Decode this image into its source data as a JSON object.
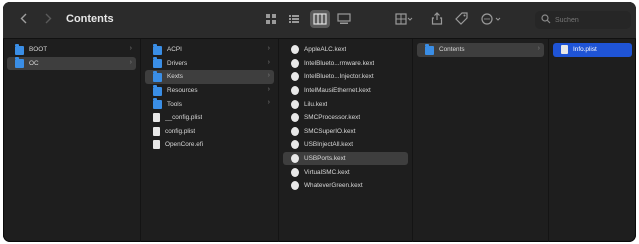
{
  "toolbar": {
    "back_icon": "chevron-left-icon",
    "forward_icon": "chevron-right-icon",
    "title": "Contents",
    "search_placeholder": "Suchen"
  },
  "columns": {
    "col1": [
      {
        "label": "BOOT",
        "icon": "folder-icon",
        "chevron": "›",
        "state": "normal"
      },
      {
        "label": "OC",
        "icon": "folder-icon",
        "chevron": "›",
        "state": "selected"
      }
    ],
    "col2": [
      {
        "label": "ACPI",
        "icon": "folder-icon",
        "chevron": "›",
        "state": "normal"
      },
      {
        "label": "Drivers",
        "icon": "folder-icon",
        "chevron": "›",
        "state": "normal"
      },
      {
        "label": "Kexts",
        "icon": "folder-icon",
        "chevron": "›",
        "state": "selected"
      },
      {
        "label": "Resources",
        "icon": "folder-icon",
        "chevron": "›",
        "state": "normal"
      },
      {
        "label": "Tools",
        "icon": "folder-icon",
        "chevron": "›",
        "state": "normal"
      },
      {
        "label": "__config.plist",
        "icon": "document-icon",
        "state": "normal"
      },
      {
        "label": "config.plist",
        "icon": "document-icon",
        "state": "normal"
      },
      {
        "label": "OpenCore.efi",
        "icon": "document-icon",
        "state": "normal"
      }
    ],
    "col3": [
      {
        "label": "AppleALC.kext",
        "icon": "kext-icon",
        "state": "normal"
      },
      {
        "label": "IntelBlueto...rmware.kext",
        "icon": "kext-icon",
        "state": "normal"
      },
      {
        "label": "IntelBlueto...Injector.kext",
        "icon": "kext-icon",
        "state": "normal"
      },
      {
        "label": "IntelMausiEthernet.kext",
        "icon": "kext-icon",
        "state": "normal"
      },
      {
        "label": "Lilu.kext",
        "icon": "kext-icon",
        "state": "normal"
      },
      {
        "label": "SMCProcessor.kext",
        "icon": "kext-icon",
        "state": "normal"
      },
      {
        "label": "SMCSuperIO.kext",
        "icon": "kext-icon",
        "state": "normal"
      },
      {
        "label": "USBInjectAll.kext",
        "icon": "kext-icon",
        "state": "normal"
      },
      {
        "label": "USBPorts.kext",
        "icon": "kext-icon",
        "state": "selected"
      },
      {
        "label": "VirtualSMC.kext",
        "icon": "kext-icon",
        "state": "normal"
      },
      {
        "label": "WhateverGreen.kext",
        "icon": "kext-icon",
        "state": "normal"
      }
    ],
    "col4": [
      {
        "label": "Contents",
        "icon": "folder-icon",
        "chevron": "›",
        "state": "selected"
      }
    ],
    "col5": [
      {
        "label": "Info.plist",
        "icon": "document-icon",
        "state": "active"
      }
    ]
  },
  "colors": {
    "window_bg": "#1e1e1e",
    "toolbar_bg": "#2b2b2b",
    "selection_inactive": "#3e3e3e",
    "selection_active": "#1f54d6",
    "folder": "#3a8ee6"
  }
}
